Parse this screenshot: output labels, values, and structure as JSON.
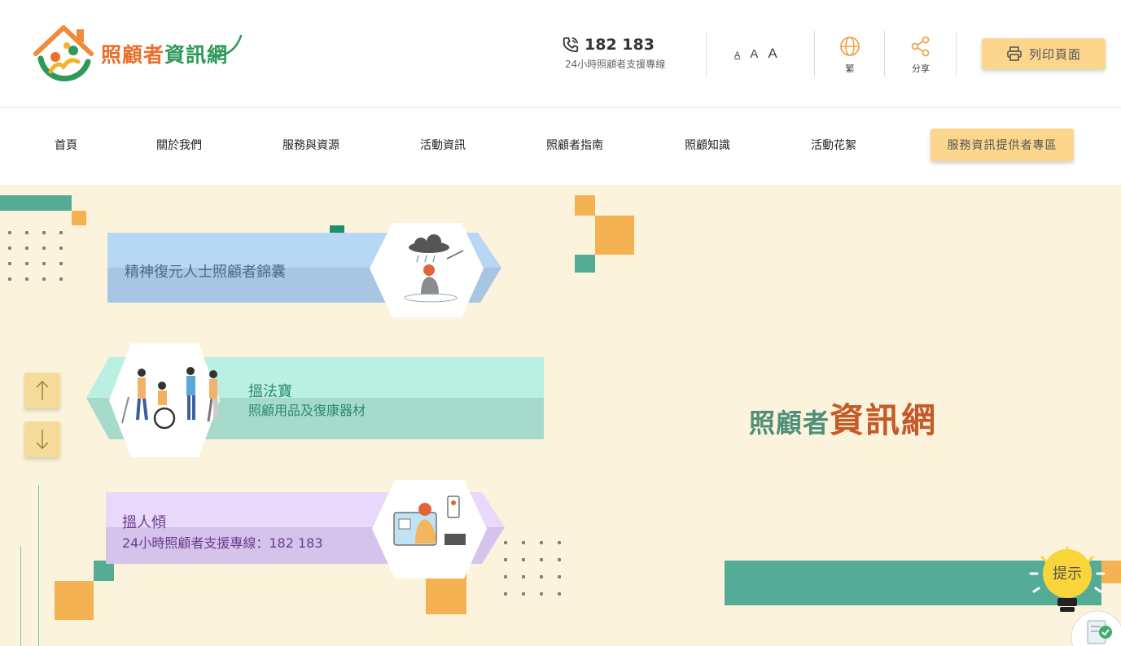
{
  "header": {
    "logo": {
      "text_part1": "照顧者",
      "text_part2": "資訊網"
    },
    "hotline": {
      "number": "182 183",
      "caption": "24小時照顧者支援專線"
    },
    "font_size": {
      "small": "A",
      "medium": "A",
      "large": "A"
    },
    "language": {
      "label": "繁"
    },
    "share": {
      "label": "分享"
    },
    "print_label": "列印頁面"
  },
  "nav": {
    "items": [
      "首頁",
      "關於我們",
      "服務與資源",
      "活動資訊",
      "照顧者指南",
      "照顧知識",
      "活動花絮"
    ],
    "special": "服務資訊提供者專區"
  },
  "cards": [
    {
      "title": "精神復元人士照顧者錦囊",
      "subtitle": "",
      "color": "#b7d8f5",
      "shade": "#a7c6e4",
      "text_color": "#4b6a8a",
      "icon": "person-under-rain-cloud-illustration"
    },
    {
      "title": "搵法寶",
      "subtitle": "照顧用品及復康器材",
      "color": "#baf0e2",
      "shade": "#a6dbcc",
      "text_color": "#2c8a6c",
      "icon": "rehab-equipment-people-illustration"
    },
    {
      "title": "搵人傾",
      "subtitle": "24小時照顧者支援專線：182 183",
      "color": "#e8d9fb",
      "shade": "#d5c3ec",
      "text_color": "#6a3d8f",
      "icon": "woman-on-phone-illustration"
    }
  ],
  "brand": {
    "part1": "照顧者",
    "part2": "資訊網"
  },
  "hint": {
    "label": "提示"
  },
  "colors": {
    "accent_yellow": "#fbd68c",
    "teal": "#55ac96",
    "orange": "#f4b252",
    "cream": "#fcf3dd"
  }
}
